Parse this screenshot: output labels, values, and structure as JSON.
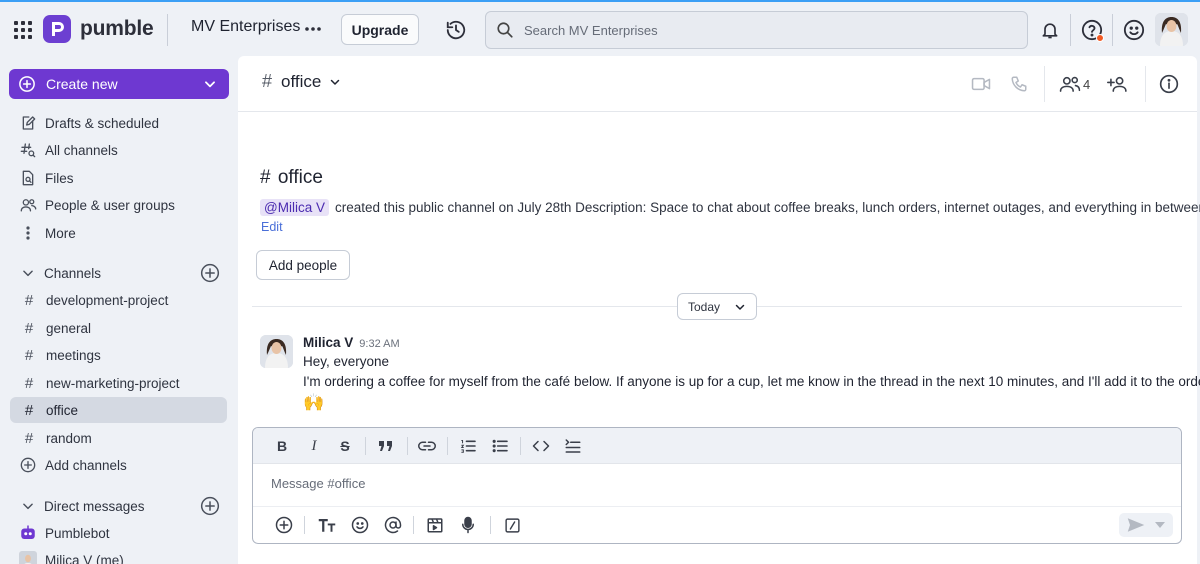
{
  "app": {
    "name": "pumble",
    "workspace": "MV Enterprises",
    "upgrade_label": "Upgrade",
    "search_placeholder": "Search MV Enterprises"
  },
  "sidebar": {
    "create_label": "Create new",
    "nav": [
      {
        "label": "Drafts & scheduled",
        "icon": "draft-icon"
      },
      {
        "label": "All channels",
        "icon": "channels-search-icon"
      },
      {
        "label": "Files",
        "icon": "file-icon"
      },
      {
        "label": "People & user groups",
        "icon": "people-icon"
      },
      {
        "label": "More",
        "icon": "more-vertical-icon"
      }
    ],
    "channels_heading": "Channels",
    "channels": [
      "development-project",
      "general",
      "meetings",
      "new-marketing-project",
      "office",
      "random"
    ],
    "active_channel": "office",
    "add_channels_label": "Add channels",
    "dm_heading": "Direct messages",
    "dms": [
      "Pumblebot",
      "Milica V (me)"
    ]
  },
  "channel": {
    "name": "office",
    "member_count": "4",
    "intro_title": "office",
    "creator_mention": "@Milica V",
    "intro_text": "created this public channel on July 28th  Description: Space to chat about coffee breaks, lunch orders, internet outages, and everything in between.",
    "edit_label": "Edit",
    "add_people_label": "Add people",
    "date_divider": "Today"
  },
  "messages": [
    {
      "author": "Milica V",
      "time": "9:32 AM",
      "lines": [
        "Hey, everyone",
        "I'm ordering a coffee for myself from the café below. If anyone is up for a cup, let me know in the thread in the next 10 minutes, and I'll add it to the order"
      ],
      "emoji": "🙌"
    }
  ],
  "composer": {
    "placeholder": "Message #office",
    "format_tools": [
      "bold",
      "italic",
      "strikethrough",
      "quote",
      "link",
      "numbered-list",
      "bullet-list",
      "code",
      "code-block"
    ],
    "bottom_tools": [
      "add",
      "text-format",
      "emoji",
      "mention",
      "video-clip",
      "microphone",
      "slash-command"
    ]
  },
  "colors": {
    "accent": "#6e38d1",
    "mention_bg": "#e8e2f7",
    "notification_dot": "#f15a24",
    "active_item": "#d4d9e2"
  }
}
